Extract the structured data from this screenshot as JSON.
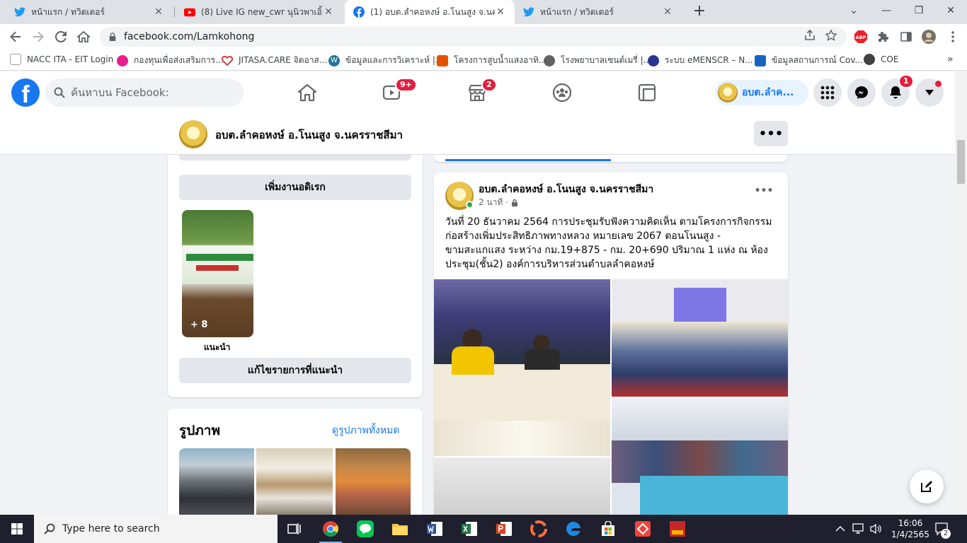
{
  "browser": {
    "tabs": [
      {
        "title": "หน้าแรก / ทวิตเตอร์",
        "icon": "twitter-icon"
      },
      {
        "title": "(8) Live IG new_cwr นุนิวพาเอิ้ยซัมเ",
        "icon": "youtube-icon"
      },
      {
        "title": "(1) อบต.ลำคอหงษ์ อ.โนนสูง จ.นครราชสีมา",
        "icon": "facebook-icon"
      },
      {
        "title": "หน้าแรก / ทวิตเตอร์",
        "icon": "twitter-icon"
      }
    ],
    "url": "facebook.com/Lamkohong",
    "bookmarks": [
      {
        "label": "NACC ITA - EIT Login",
        "color": "#9e9e9e"
      },
      {
        "label": "กองทุนเพื่อส่งเสริมการ...",
        "color": "#e91e8c"
      },
      {
        "label": "JITASA.CARE จิตอาส...",
        "color": "#d32f2f"
      },
      {
        "label": "ข้อมูลและการวิเคราะห์ |...",
        "color": "#21759b"
      },
      {
        "label": "โครงการสูบน้ำแสงอาทิ...",
        "color": "#e65100"
      },
      {
        "label": "โรงพยาบาลเซนต์เมรี่ |...",
        "color": "#616161"
      },
      {
        "label": "ระบบ eMENSCR – N...",
        "color": "#283593"
      },
      {
        "label": "ข้อมูลสถานการณ์ Cov...",
        "color": "#1565c0"
      },
      {
        "label": "COE",
        "color": "#424242"
      }
    ],
    "ext_abp": "ABP"
  },
  "fb": {
    "search_placeholder": "ค้นหาบน Facebook:",
    "watch_badge": "9+",
    "marketplace_badge": "2",
    "notif_badge": "1",
    "profile_name": "อบต.ลำค..."
  },
  "page": {
    "name": "อบต.ลำคอหงษ์ อ.โนนสูง จ.นครราชสีมา",
    "more_label": "•••"
  },
  "left": {
    "add_featured": "เพิ่มงานอดิเรก",
    "featured_more": "+ 8",
    "featured_caption": "แนะนำ",
    "edit_featured": "แก้ไขรายการที่แนะนำ",
    "photos_title": "รูปภาพ",
    "photos_link": "ดูรูปภาพทั้งหมด"
  },
  "post": {
    "author": "อบต.ลำคอหงษ์ อ.โนนสูง จ.นครราชสีมา",
    "time": "2 นาที ·",
    "more": "•••",
    "lines": [
      "วันที่ 20 ธันวาคม 2564 การประชุมรับฟังความคิดเห็น ตามโครงการกิจกรรม",
      "ก่อสร้างเพิ่มประสิทธิภาพทางหลวง หมายเลข 2067 ตอนโนนสูง -",
      "ขามสะแกแสง ระหว่าง กม.19+875 - กม. 20+690 ปริมาณ 1 แห่ง  ณ ห้อง",
      "ประชุม(ชั้น2) องค์การบริหารส่วนตำบลลำคอหงษ์"
    ]
  },
  "taskbar": {
    "search_placeholder": "Type here to search",
    "time": "16:06",
    "date": "1/4/2565",
    "notif_count": "2"
  }
}
